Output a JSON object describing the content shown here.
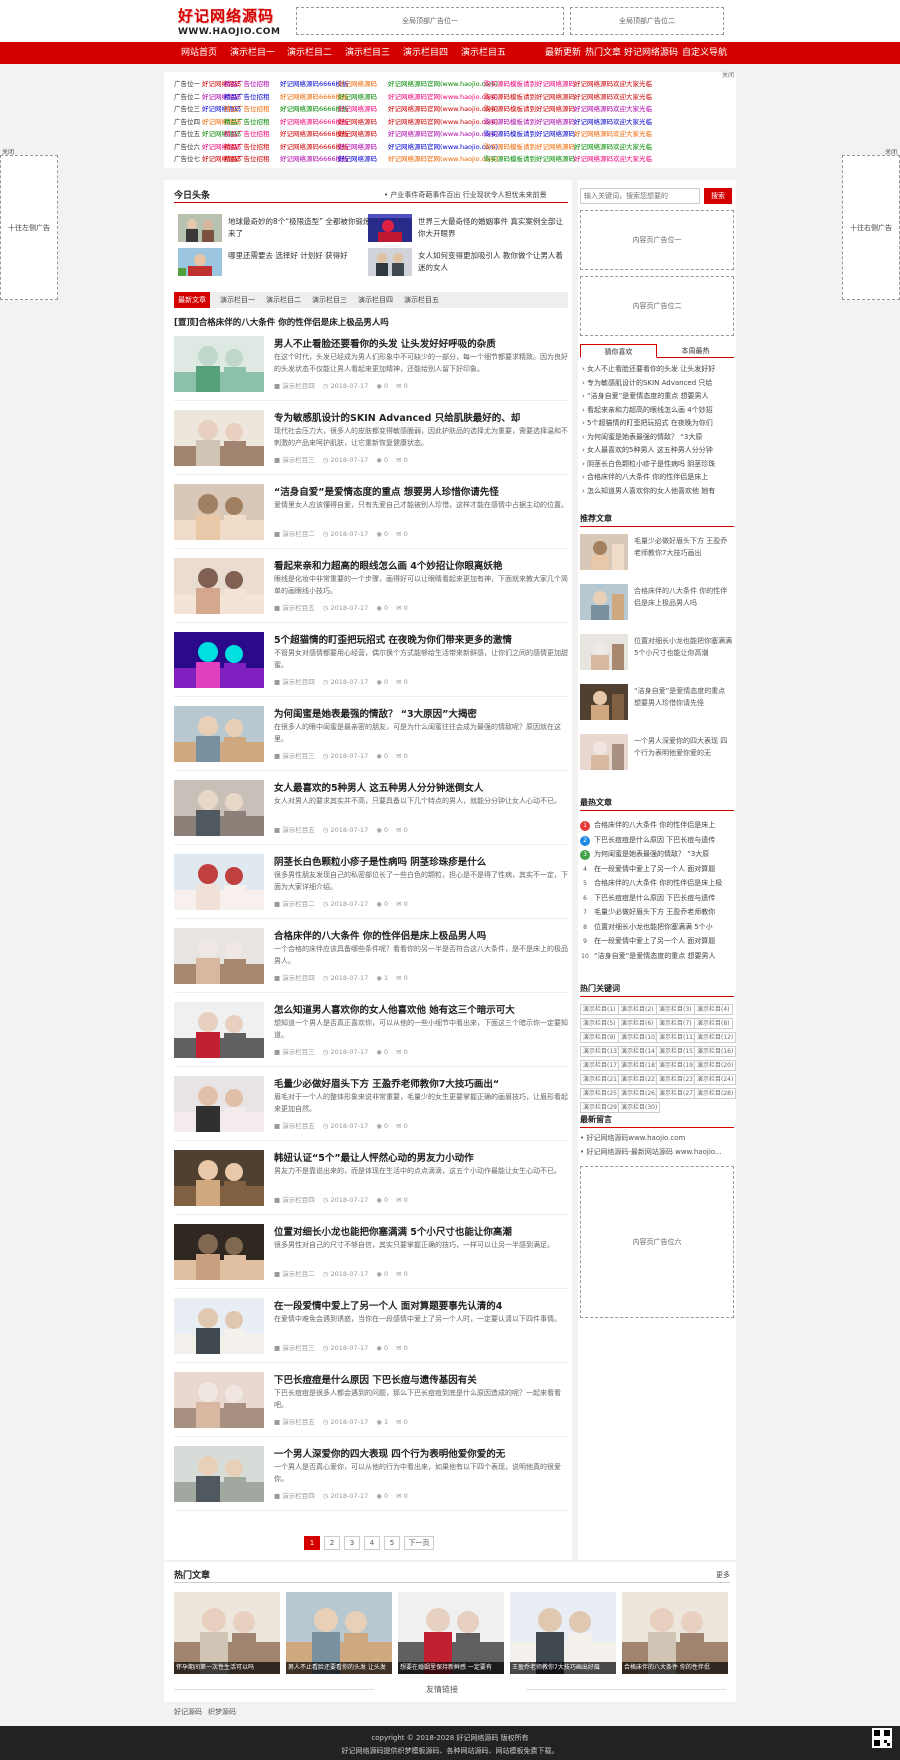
{
  "header": {
    "logo_cn": "好记网络源码",
    "logo_en": "WWW.HAOJIO.COM",
    "ad1": "全局顶部广告位一",
    "ad2": "全局顶部广告位二"
  },
  "nav": {
    "items": [
      "网站首页",
      "演示栏目一",
      "演示栏目二",
      "演示栏目三",
      "演示栏目四",
      "演示栏目五"
    ],
    "right": [
      "最新更新",
      "热门文章",
      "好记网络源码",
      "自定义导航"
    ]
  },
  "links_panel": {
    "close": "关闭",
    "rows": [
      {
        "label": "广告位一",
        "links": [
          "好记网络源码",
          "精品广告位招租",
          "好记网络源码6666模板",
          "好记网络源码",
          "好记网络源码官网(www.haojio.com)",
          "购买源码模板请到好记网络源码",
          "好记网络源码欢迎大家光临"
        ]
      },
      {
        "label": "广告位二",
        "links": [
          "好记网络源码",
          "精品广告位招租",
          "好记网络源码6666模板",
          "好记网络源码",
          "好记网络源码官网(www.haojio.com)",
          "购买源码模板请到好记网络源码",
          "好记网络源码欢迎大家光临"
        ]
      },
      {
        "label": "广告位三",
        "links": [
          "好记网络源码",
          "精品广告位招租",
          "好记网络源码6666模板",
          "好记网络源码",
          "好记网络源码官网(www.haojio.com)",
          "购买源码模板请到好记网络源码",
          "好记网络源码欢迎大家光临"
        ]
      },
      {
        "label": "广告位四",
        "links": [
          "好记网络源码",
          "精品广告位招租",
          "好记网络源码6666模板",
          "好记网络源码",
          "好记网络源码官网(www.haojio.com)",
          "购买源码模板请到好记网络源码",
          "好记网络源码欢迎大家光临"
        ]
      },
      {
        "label": "广告位五",
        "links": [
          "好记网络源码",
          "精品广告位招租",
          "好记网络源码6666模板",
          "好记网络源码",
          "好记网络源码官网(www.haojio.com)",
          "购买源码模板请到好记网络源码",
          "好记网络源码欢迎大家光临"
        ]
      },
      {
        "label": "广告位六",
        "links": [
          "好记网络源码",
          "精品广告位招租",
          "好记网络源码6666模板",
          "好记网络源码",
          "好记网络源码官网(www.haojio.com)",
          "购买源码模板请到好记网络源码",
          "好记网络源码欢迎大家光临"
        ]
      },
      {
        "label": "广告位七",
        "links": [
          "好记网络源码",
          "精品广告位招租",
          "好记网络源码6666模板",
          "好记网络源码",
          "好记网络源码官网(www.haojio.com)",
          "购买源码模板请到好记网络源码",
          "好记网络源码欢迎大家光临"
        ]
      }
    ]
  },
  "side_ads": {
    "left": "十往左侧广告",
    "right": "十往右侧广告",
    "close_left": "关闭",
    "close_right": "关闭"
  },
  "headlines": {
    "title": "今日头条",
    "marquee": "• 产业事件奇葩事件百出 行业现状令人担忧未来前景",
    "items": [
      "地球最奇妙的8个“极限造型” 全都被你锻炼出来了",
      "世界三大最奇怪的婚姻事件 真实案例全部让你大开眼界",
      "哪里还需要去 选择好 计划好 获得好",
      "女人如何变得更加吸引人 教你做个让男人着迷的女人"
    ]
  },
  "tabs": [
    "最新文章",
    "演示栏目一",
    "演示栏目二",
    "演示栏目三",
    "演示栏目四",
    "演示栏目五"
  ],
  "featured": "[置顶]合格床伴的八大条件 你的性伴侣是床上极品男人吗",
  "articles": [
    {
      "title": "男人不止看脸还要看你的头发 让头发好好呼吸的杂质",
      "summary": "在这个时代，头发已经成为男人们形象中不可缺少的一部分，每一个细节都要求精致。因为良好的头发状态不仅能让男人看起来更加精神，还能给别人留下好印象。",
      "col": "演示栏目四",
      "date": "2018-07-17",
      "views": "0",
      "comments": "0"
    },
    {
      "title": "专为敏感肌设计的SKIN Advanced 只给肌肤最好的、却",
      "summary": "现代社会压力大，很多人的皮肤都变得敏感脆弱，因此护肤品的选择尤为重要，需要选择温和不刺激的产品来呵护肌肤，让它重新恢复健康状态。",
      "col": "演示栏目三",
      "date": "2018-07-17",
      "views": "0",
      "comments": "0"
    },
    {
      "title": "“洁身自爱”是爱情态度的重点 想要男人珍惜你请先怪",
      "summary": "爱情里女人应该懂得自爱，只有先爱自己才能被别人珍惜，这样才能在感情中占据主动的位置。",
      "col": "演示栏目二",
      "date": "2018-07-17",
      "views": "0",
      "comments": "0"
    },
    {
      "title": "看起来亲和力超高的眼线怎么画 4个妙招让你眼离妖艳",
      "summary": "眼线是化妆中非常重要的一个步骤，画得好可以让眼睛看起来更加有神，下面就来教大家几个简单的画眼线小技巧。",
      "col": "演示栏目五",
      "date": "2018-07-17",
      "views": "0",
      "comments": "0"
    },
    {
      "title": "5个超猫情的盯歪把玩招式 在夜晚为你们带来更多的激情",
      "summary": "不管男女对感情都要用心经营，偶尔换个方式能够给生活带来新鲜感，让你们之间的感情更加甜蜜。",
      "col": "演示栏目四",
      "date": "2018-07-17",
      "views": "0",
      "comments": "0"
    },
    {
      "title": "为何闺蜜是她表最强的情敌？ “3大原因”大揭密",
      "summary": "在很多人的眼中闺蜜是最亲密的朋友，可是为什么闺蜜往往会成为最强的情敌呢？原因就在这里。",
      "col": "演示栏目三",
      "date": "2018-07-17",
      "views": "0",
      "comments": "0"
    },
    {
      "title": "女人最喜欢的5种男人 这五种男人分分钟迷倒女人",
      "summary": "女人对男人的要求其实并不高，只要具备以下几个特点的男人，就能分分钟让女人心动不已。",
      "col": "演示栏目五",
      "date": "2018-07-17",
      "views": "0",
      "comments": "0"
    },
    {
      "title": "阴茎长白色颗粒小疹子是性病吗 阴茎珍珠疹是什么",
      "summary": "很多男性朋友发现自己的私密部位长了一些白色的颗粒，担心是不是得了性病，其实不一定，下面为大家详细介绍。",
      "col": "演示栏目二",
      "date": "2018-07-17",
      "views": "0",
      "comments": "0"
    },
    {
      "title": "合格床伴的八大条件 你的性伴侣是床上极品男人吗",
      "summary": "一个合格的床伴应该具备哪些条件呢？看看你的另一半是否符合这八大条件，是不是床上的极品男人。",
      "col": "演示栏目四",
      "date": "2018-07-17",
      "views": "1",
      "comments": "0"
    },
    {
      "title": "怎么知道男人喜欢你的女人他喜欢他 她有这三个暗示可大",
      "summary": "想知道一个男人是否真正喜欢你，可以从他的一些小细节中看出来，下面这三个暗示你一定要知道。",
      "col": "演示栏目三",
      "date": "2018-07-17",
      "views": "0",
      "comments": "0"
    },
    {
      "title": "毛量少必做好眉头下方 王盈乔老师教你7大技巧画出“",
      "summary": "眉毛对于一个人的整体形象来说非常重要，毛量少的女生更要掌握正确的画眉技巧，让眉形看起来更加自然。",
      "col": "演示栏目五",
      "date": "2018-07-17",
      "views": "0",
      "comments": "0"
    },
    {
      "title": "韩妞认证“5个”最让人怦然心动的男友力小动作",
      "summary": "男友力不是靠说出来的，而是体现在生活中的点点滴滴，这五个小动作最能让女生心动不已。",
      "col": "演示栏目四",
      "date": "2018-07-17",
      "views": "0",
      "comments": "0"
    },
    {
      "title": "位置对细长小龙也能把你塞满满 5个小尺寸也能让你高潮",
      "summary": "很多男性对自己的尺寸不够自信，其实只要掌握正确的技巧，一样可以让另一半感到满足。",
      "col": "演示栏目二",
      "date": "2018-07-17",
      "views": "0",
      "comments": "0"
    },
    {
      "title": "在一段爱情中爱上了另一个人 面对算题要事先认清的4",
      "summary": "在爱情中难免会遇到诱惑，当你在一段感情中爱上了另一个人时，一定要认清以下四件事情。",
      "col": "演示栏目三",
      "date": "2018-07-17",
      "views": "0",
      "comments": "0"
    },
    {
      "title": "下巴长痘痘是什么原因 下巴长痘与遗传基因有关",
      "summary": "下巴长痘痘是很多人都会遇到的问题，那么下巴长痘痘到底是什么原因造成的呢？一起来看看吧。",
      "col": "演示栏目五",
      "date": "2018-07-17",
      "views": "1",
      "comments": "0"
    },
    {
      "title": "一个男人深爱你的四大表现 四个行为表明他爱你爱的无",
      "summary": "一个男人是否真心爱你，可以从他的行为中看出来，如果他有以下四个表现，说明他真的很爱你。",
      "col": "演示栏目四",
      "date": "2018-07-17",
      "views": "0",
      "comments": "0"
    }
  ],
  "pager": [
    "1",
    "2",
    "3",
    "4",
    "5",
    "下一页"
  ],
  "sidebar": {
    "search_placeholder": "输入关键词，搜索您想要的",
    "search_btn": "搜索",
    "ad1": "内容页广告位一",
    "ad2": "内容页广告位二",
    "tab1": "猜你喜欢",
    "tab2": "本周最热",
    "list": [
      "女人不止看脸还要看你的头发 让头发好好",
      "专为敏感肌设计的SKIN Advanced 只给",
      "“洁身自爱”是爱情态度的重点 想要男人",
      "看起来亲和力超高的眼线怎么画 4个妙招",
      "5个超猫情的盯歪把玩招式 在夜晚为你们",
      "为何闺蜜是她表最强的情敌？ “3大原",
      "女人最喜欢的5种男人 这五种男人分分钟",
      "阴茎长白色颗粒小疹子是性病吗 阴茎珍珠",
      "合格床伴的八大条件 你的性伴侣是床上",
      "怎么知道男人喜欢你的女人他喜欢他 她有"
    ],
    "rec_title": "推荐文章",
    "rec": [
      "毛量少必做好眉头下方 王盈乔老师教你7大技巧画出",
      "合格床伴的八大条件 你的性伴侣是床上极品男人吗",
      "位置对细长小龙也能把你塞满满 5个小尺寸也能让你高潮",
      "“洁身自爱”是爱情态度的重点 想要男人珍惜你请先怪",
      "一个男人深爱你的四大表现 四个行为表明他爱你爱的无"
    ],
    "hot_title": "最热文章",
    "hot": [
      "合格床伴的八大条件 你的性伴侣是床上",
      "下巴长痘痘是什么原因 下巴长痘与遗传",
      "为何闺蜜是她表最强的情敌？ “3大原",
      "在一段爱情中爱上了另一个人 面对算题",
      "合格床伴的八大条件 你的性伴侣是床上极",
      "下巴长痘痘是什么原因 下巴长痘与遗传",
      "毛量少必做好眉头下方 王盈乔老师教你",
      "位置对细长小龙也能把你塞满满 5个小",
      "在一段爱情中爱上了另一个人 面对算题",
      "“洁身自爱”是爱情态度的重点 想要男人"
    ],
    "kw_title": "热门关键词",
    "keywords": [
      "演示栏目(1)",
      "演示栏目(2)",
      "演示栏目(3)",
      "演示栏目(4)",
      "演示栏目(5)",
      "演示栏目(6)",
      "演示栏目(7)",
      "演示栏目(8)",
      "演示栏目(9)",
      "演示栏目(10)",
      "演示栏目(11)",
      "演示栏目(12)",
      "演示栏目(13)",
      "演示栏目(14)",
      "演示栏目(15)",
      "演示栏目(16)",
      "演示栏目(17)",
      "演示栏目(18)",
      "演示栏目(19)",
      "演示栏目(20)",
      "演示栏目(21)",
      "演示栏目(22)",
      "演示栏目(23)",
      "演示栏目(24)",
      "演示栏目(25)",
      "演示栏目(26)",
      "演示栏目(27)",
      "演示栏目(28)",
      "演示栏目(29)",
      "演示栏目(30)"
    ],
    "cmt_title": "最新留言",
    "comments": [
      "• 好记网络源码www.haojio.com",
      "• 好记网络源码-最新网站源码 www.haojio..."
    ],
    "ad3": "内容页广告位六"
  },
  "bottom": {
    "title": "热门文章",
    "more": "更多",
    "items": [
      "怀孕期间第一次性生活可以吗",
      "男人不止看脸还要看你的头发 让头发",
      "想要在婚姻里保持新鲜感 一定要有",
      "王盈乔老师教你7大技巧画出好眉",
      "合格床伴的八大条件 你的性伴侣"
    ],
    "links_title": "友情链接",
    "links": [
      "好记源码",
      "织梦源码"
    ]
  },
  "footer": {
    "line1": "copyright © 2018-2028 好记网络源码 版权所有",
    "line2": "好记网络源码提供织梦模板源码、各种网站源码、网站模板免费下载。"
  }
}
